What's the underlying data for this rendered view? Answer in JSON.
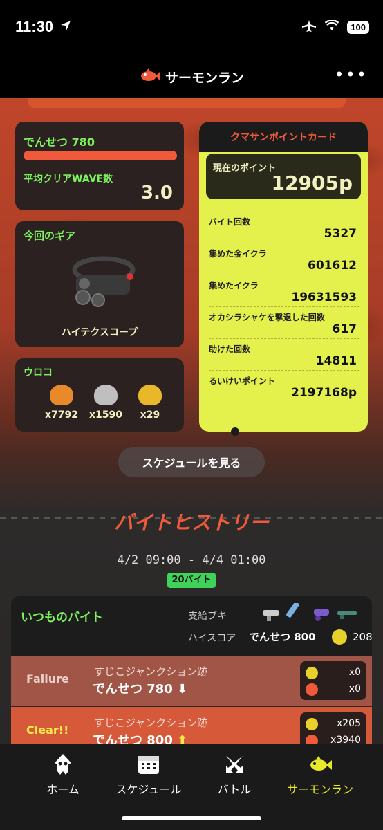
{
  "status_bar": {
    "time": "11:30",
    "battery": "100"
  },
  "header": {
    "title": "サーモンラン",
    "more_icon": "ellipsis-icon"
  },
  "rank_panel": {
    "rank_label": "でんせつ 780",
    "wave_label": "平均クリアWAVE数",
    "wave_value": "3.0"
  },
  "gear_panel": {
    "title": "今回のギア",
    "gear_name": "ハイテクスコープ"
  },
  "scales_panel": {
    "title": "ウロコ",
    "items": [
      {
        "count": "x7792",
        "color": "#e88a2a"
      },
      {
        "count": "x1590",
        "color": "#bfbfbf"
      },
      {
        "count": "x29",
        "color": "#e8b82a"
      }
    ]
  },
  "point_card": {
    "title": "クマサンポイントカード",
    "current_label": "現在のポイント",
    "current_value": "12905p",
    "stats": [
      {
        "label": "バイト回数",
        "value": "5327"
      },
      {
        "label": "集めた金イクラ",
        "value": "601612"
      },
      {
        "label": "集めたイクラ",
        "value": "19631593"
      },
      {
        "label": "オカシラシャケを撃退した回数",
        "value": "617"
      },
      {
        "label": "助けた回数",
        "value": "14811"
      },
      {
        "label": "るいけいポイント",
        "value": "2197168p"
      }
    ]
  },
  "schedule_button": "スケジュールを見る",
  "history": {
    "title": "バイトヒストリー",
    "period": "4/2 09:00 - 4/4 01:00",
    "count": "20バイト",
    "shift": {
      "title": "いつものバイト",
      "supply_label": "支給ブキ",
      "hiscore_label": "ハイスコア",
      "hiscore_rank": "でんせつ 800",
      "hiscore_eggs": "208"
    },
    "results": [
      {
        "status": "Failure",
        "stage": "すじこジャンクション跡",
        "rank": "でんせつ 780",
        "arrow": "⬇",
        "golden": "x0",
        "eggs": "x0"
      },
      {
        "status": "Clear!!",
        "stage": "すじこジャンクション跡",
        "rank": "でんせつ 800",
        "arrow": "⬆",
        "golden": "x205",
        "eggs": "x3940"
      }
    ]
  },
  "tabs": [
    {
      "label": "ホーム",
      "icon": "squid-icon"
    },
    {
      "label": "スケジュール",
      "icon": "calendar-icon"
    },
    {
      "label": "バトル",
      "icon": "crossed-swords-icon"
    },
    {
      "label": "サーモンラン",
      "icon": "salmon-icon"
    }
  ],
  "colors": {
    "accent_green": "#7cf25c",
    "accent_orange": "#f05a3a",
    "card_yellow": "#e4f04c",
    "active_tab": "#e8e82c"
  }
}
